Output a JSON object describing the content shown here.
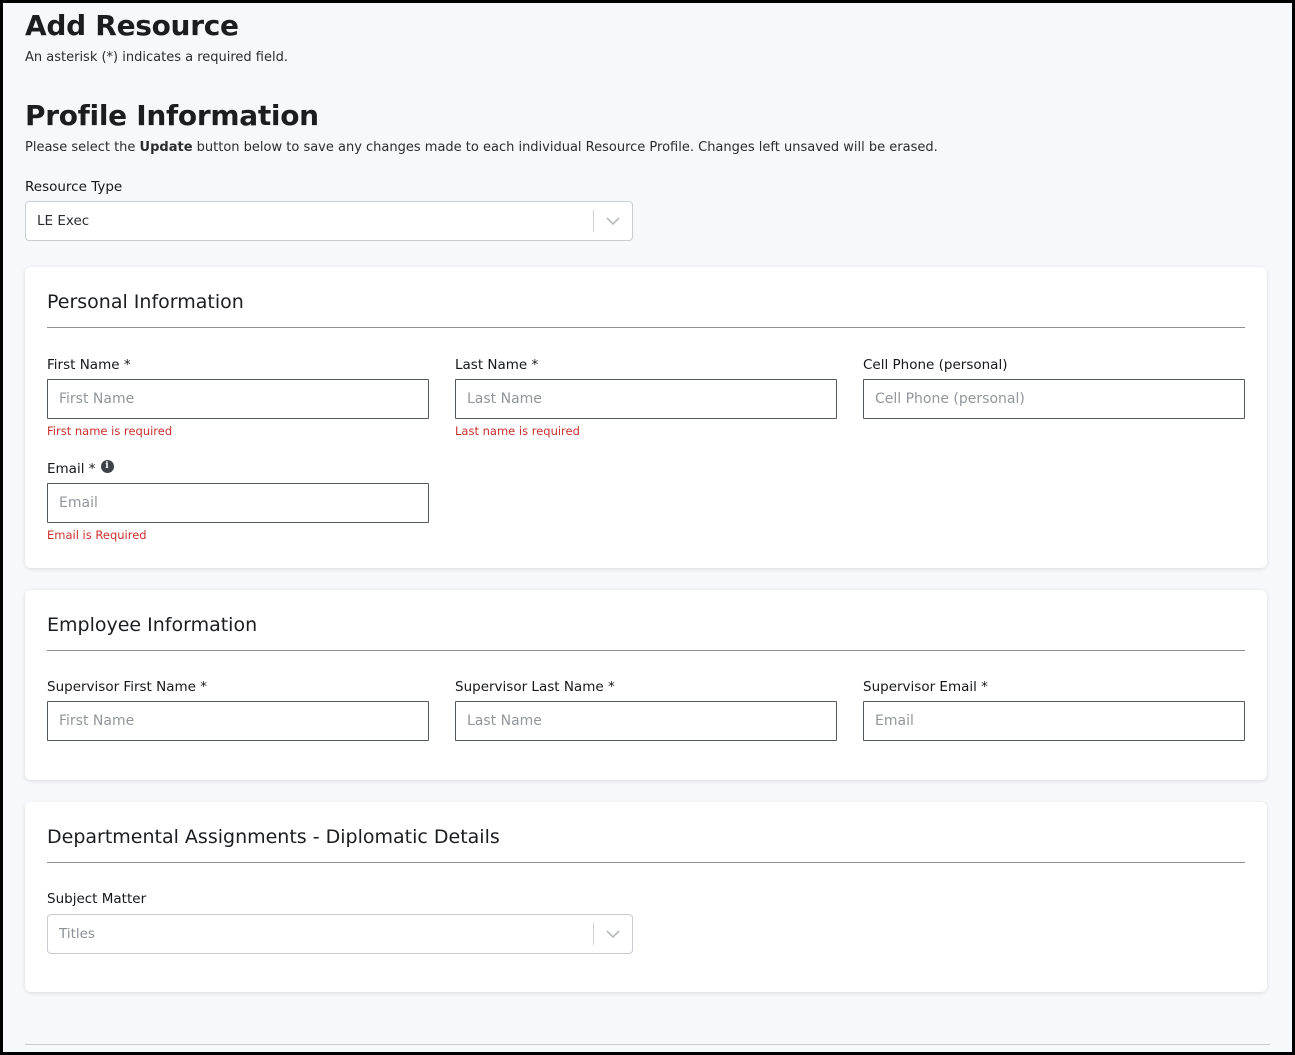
{
  "header": {
    "title": "Add Resource",
    "subtitle": "An asterisk (*) indicates a required field."
  },
  "profile": {
    "title": "Profile Information",
    "desc_before": "Please select the ",
    "desc_bold": "Update",
    "desc_after": " button below to save any changes made to each individual Resource Profile. Changes left unsaved will be erased.",
    "resource_type_label": "Resource Type",
    "resource_type_value": "LE Exec"
  },
  "personal": {
    "title": "Personal Information",
    "first_name_label": "First Name *",
    "first_name_placeholder": "First Name",
    "first_name_error": "First name is required",
    "last_name_label": "Last Name *",
    "last_name_placeholder": "Last Name",
    "last_name_error": "Last name is required",
    "cell_label": "Cell Phone (personal)",
    "cell_placeholder": "Cell Phone (personal)",
    "email_label": "Email *",
    "email_placeholder": "Email",
    "email_error": "Email is Required"
  },
  "employee": {
    "title": "Employee Information",
    "sup_first_label": "Supervisor First Name *",
    "sup_first_placeholder": "First Name",
    "sup_last_label": "Supervisor Last Name *",
    "sup_last_placeholder": "Last Name",
    "sup_email_label": "Supervisor Email *",
    "sup_email_placeholder": "Email"
  },
  "departmental": {
    "title": "Departmental Assignments - Diplomatic Details",
    "subject_label": "Subject Matter",
    "subject_placeholder": "Titles"
  },
  "icons": {
    "info": "info-icon",
    "chevron": "chevron-down-icon"
  },
  "colors": {
    "error": "#c9302c",
    "background": "#f7f8fb"
  }
}
